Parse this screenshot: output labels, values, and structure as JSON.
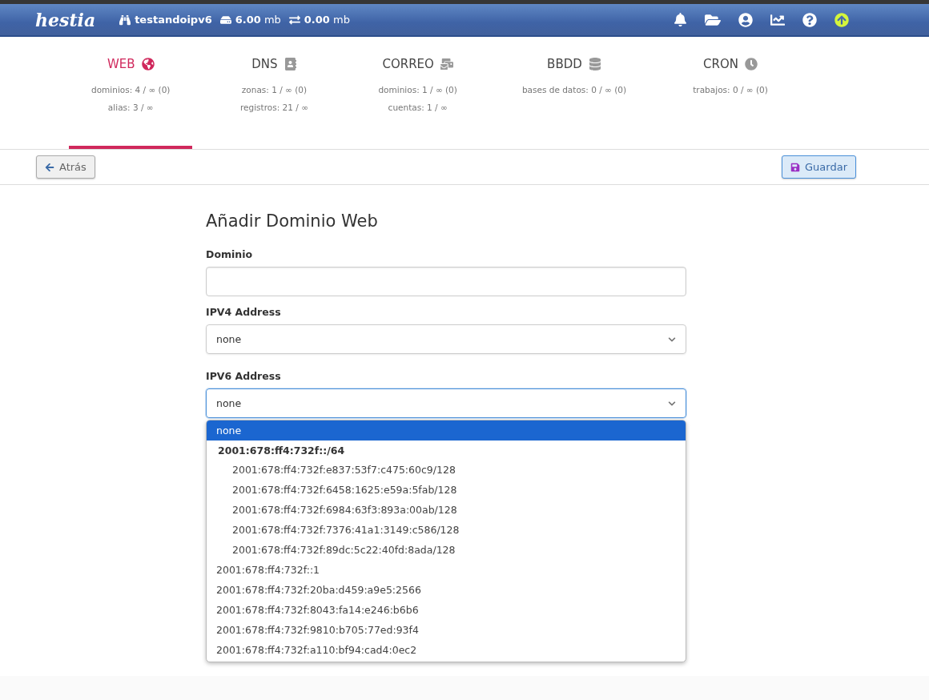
{
  "topbar": {
    "logo": "hestia",
    "user": "testandoipv6",
    "disk": "**6.00** mb",
    "bandwidth": "**0.00** mb",
    "update_available": true
  },
  "tabs": [
    {
      "label": "WEB",
      "selected": true,
      "stats": [
        "dominios: 4 / ∞ (0)",
        "alias: 3 / ∞"
      ]
    },
    {
      "label": "DNS",
      "selected": false,
      "stats": [
        "zonas: 1 / ∞ (0)",
        "registros: 21 / ∞"
      ]
    },
    {
      "label": "CORREO",
      "selected": false,
      "stats": [
        "dominios: 1 / ∞ (0)",
        "cuentas: 1 / ∞"
      ]
    },
    {
      "label": "BBDD",
      "selected": false,
      "stats": [
        "bases de datos: 0 / ∞ (0)"
      ]
    },
    {
      "label": "CRON",
      "selected": false,
      "stats": [
        "trabajos: 0 / ∞ (0)"
      ]
    }
  ],
  "toolbar": {
    "back": "Atrás",
    "save": "Guardar"
  },
  "form": {
    "title": "Añadir Dominio Web",
    "fields": [
      {
        "kind": "text",
        "label": "Dominio"
      },
      {
        "kind": "select",
        "label": "IPV4 Address",
        "value": "none",
        "expanded": false
      },
      {
        "kind": "select",
        "label": "IPV6 Address",
        "value": "none",
        "expanded": true,
        "options": [
          {
            "kind": "option",
            "label": "none",
            "selected": true
          },
          {
            "kind": "group",
            "label": "2001:678:ff4:732f::/64",
            "children": [
              {
                "kind": "option",
                "label": "2001:678:ff4:732f:e837:53f7:c475:60c9/128",
                "selected": false
              },
              {
                "kind": "option",
                "label": "2001:678:ff4:732f:6458:1625:e59a:5fab/128",
                "selected": false
              },
              {
                "kind": "option",
                "label": "2001:678:ff4:732f:6984:63f3:893a:00ab/128",
                "selected": false
              },
              {
                "kind": "option",
                "label": "2001:678:ff4:732f:7376:41a1:3149:c586/128",
                "selected": false
              },
              {
                "kind": "option",
                "label": "2001:678:ff4:732f:89dc:5c22:40fd:8ada/128",
                "selected": false
              }
            ]
          },
          {
            "kind": "option",
            "label": "2001:678:ff4:732f::1",
            "selected": false
          },
          {
            "kind": "option",
            "label": "2001:678:ff4:732f:20ba:d459:a9e5:2566",
            "selected": false
          },
          {
            "kind": "option",
            "label": "2001:678:ff4:732f:8043:fa14:e246:b6b6",
            "selected": false
          },
          {
            "kind": "option",
            "label": "2001:678:ff4:732f:9810:b705:77ed:93f4",
            "selected": false
          },
          {
            "kind": "option",
            "label": "2001:678:ff4:732f:a110:bf94:cad4:0ec2",
            "selected": false
          }
        ]
      }
    ]
  }
}
